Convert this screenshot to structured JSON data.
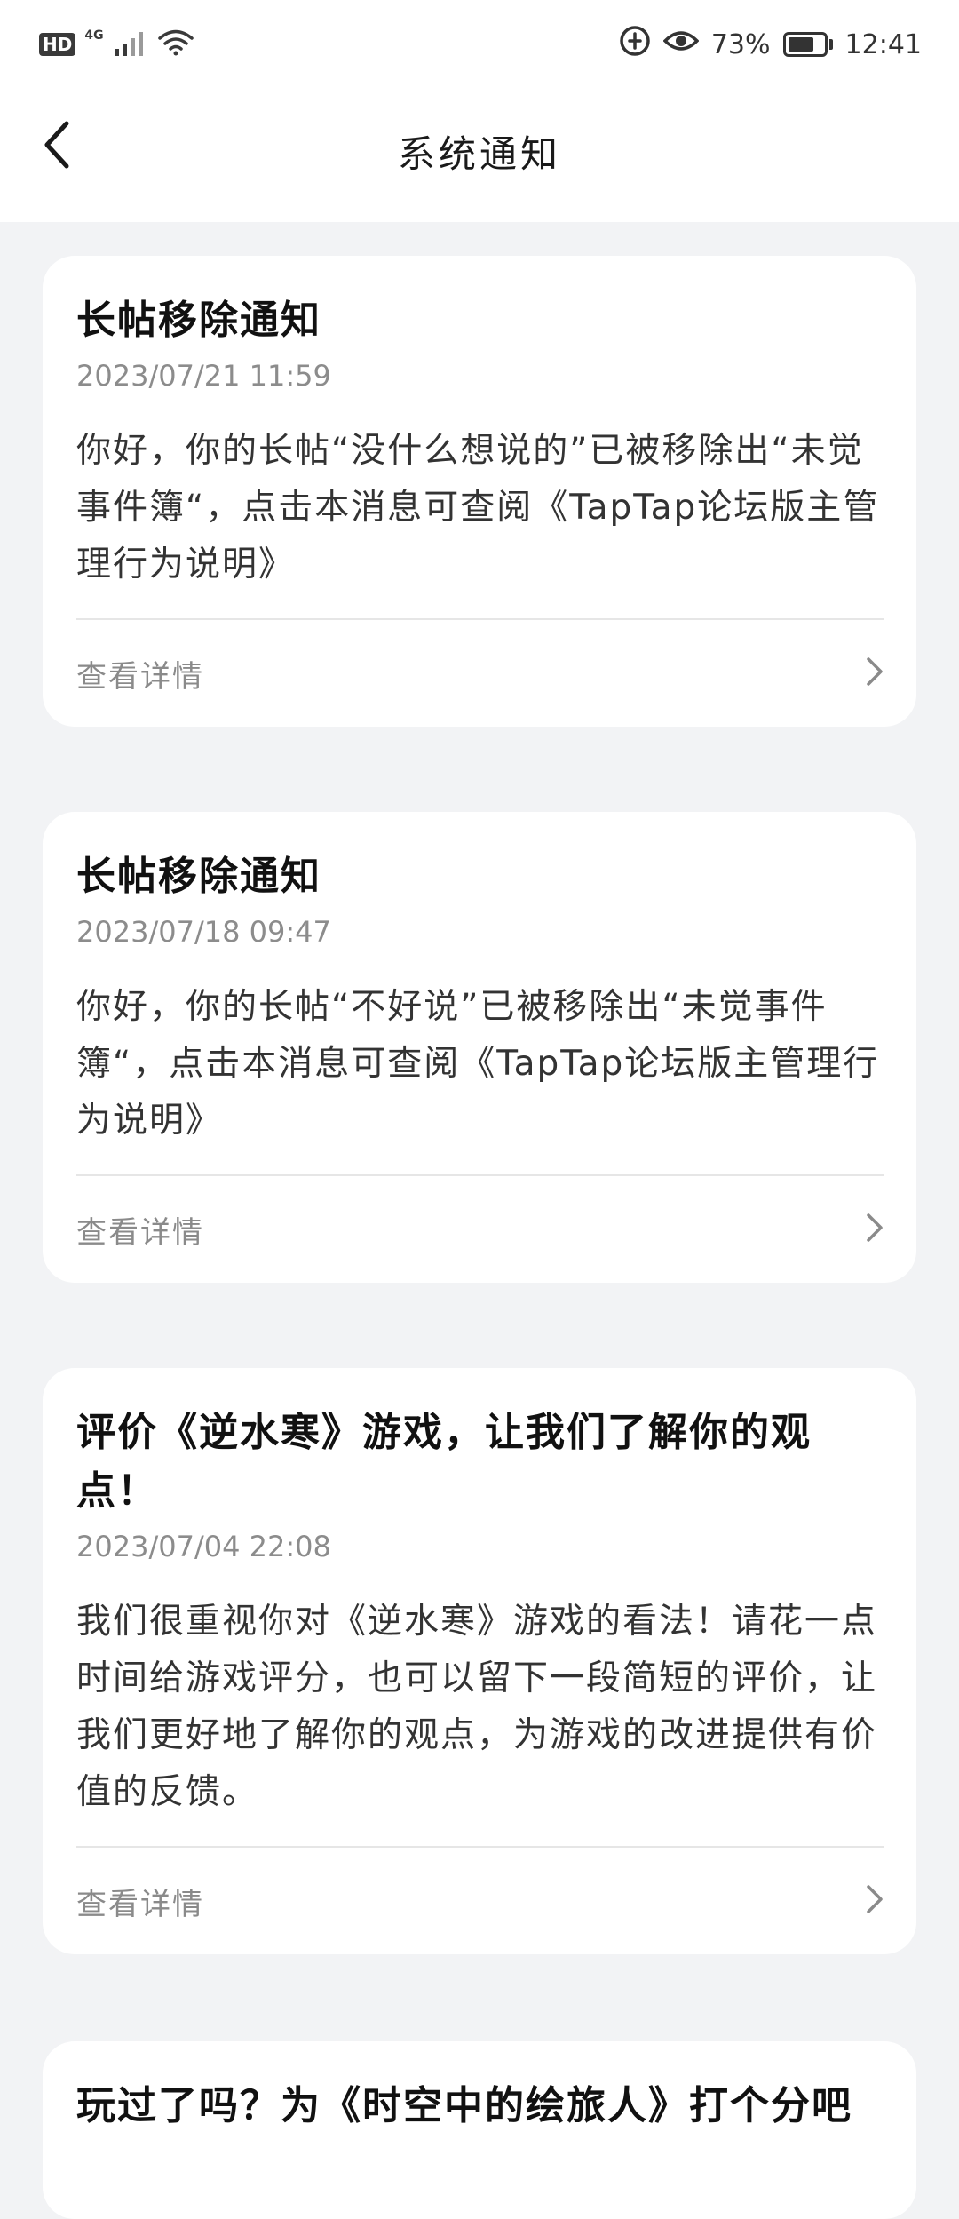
{
  "status_bar": {
    "hd": "HD",
    "network": "4G",
    "battery_percent": "73%",
    "battery_level": 0.73,
    "time": "12:41"
  },
  "nav": {
    "title": "系统通知",
    "back_icon": "chevron-left-icon"
  },
  "notifications": [
    {
      "title": "长帖移除通知",
      "time": "2023/07/21 11:59",
      "body": "你好，你的长帖“没什么想说的”已被移除出“未觉事件簿“，点击本消息可查阅《TapTap论坛版主管理行为说明》",
      "action": "查看详情"
    },
    {
      "title": "长帖移除通知",
      "time": "2023/07/18 09:47",
      "body": "你好，你的长帖“不好说”已被移除出“未觉事件簿“，点击本消息可查阅《TapTap论坛版主管理行为说明》",
      "action": "查看详情"
    },
    {
      "title": "评价《逆水寒》游戏，让我们了解你的观点！",
      "time": "2023/07/04 22:08",
      "body": "我们很重视你对《逆水寒》游戏的看法！请花一点时间给游戏评分，也可以留下一段简短的评价，让我们更好地了解你的观点，为游戏的改进提供有价值的反馈。",
      "action": "查看详情"
    },
    {
      "title": "玩过了吗？为《时空中的绘旅人》打个分吧"
    }
  ],
  "colors": {
    "page_background": "#f2f3f5",
    "card_background": "#ffffff",
    "title_text": "#111111",
    "secondary_text": "#8c8c8c"
  }
}
